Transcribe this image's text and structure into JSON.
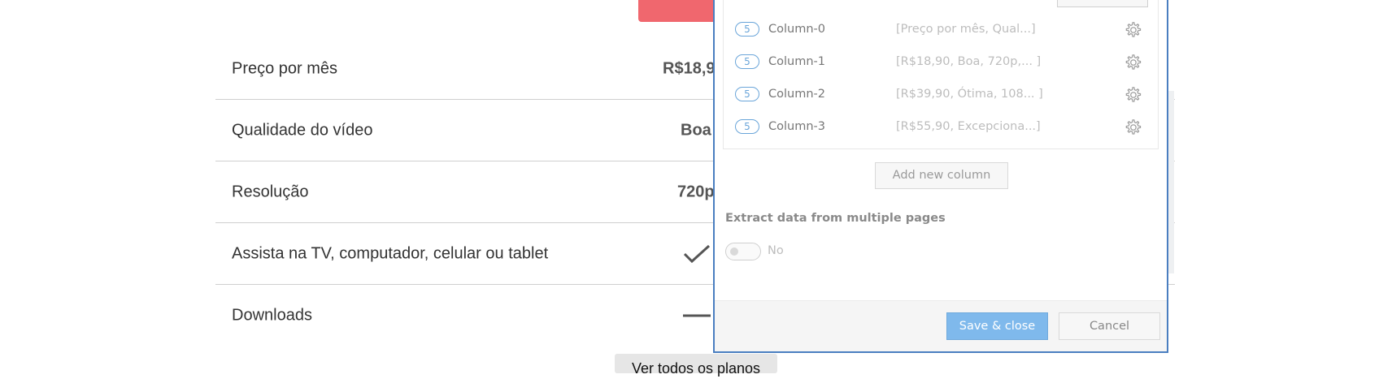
{
  "page": {
    "rows": [
      {
        "label": "Preço por mês",
        "value": "R$18,9"
      },
      {
        "label": "Qualidade do vídeo",
        "value": "Boa"
      },
      {
        "label": "Resolução",
        "value": "720p"
      },
      {
        "label": "Assista na TV, computador, celular ou tablet",
        "value_icon": "check-icon"
      },
      {
        "label": "Downloads",
        "value_icon": "dash-icon"
      }
    ],
    "see_all_label": "Ver todos os planos"
  },
  "dialog": {
    "columns": [
      {
        "count": "5",
        "name": "Column-0",
        "preview": "[Preço por mês, Qual...]"
      },
      {
        "count": "5",
        "name": "Column-1",
        "preview": "[R$18,90, Boa, 720p,... ]"
      },
      {
        "count": "5",
        "name": "Column-2",
        "preview": "[R$39,90, Ótima, 108... ]"
      },
      {
        "count": "5",
        "name": "Column-3",
        "preview": "[R$55,90, Excepciona...]"
      }
    ],
    "add_column_label": "Add new column",
    "multi_page_label": "Extract data from multiple pages",
    "multi_page_toggle_text": "No",
    "save_label": "Save & close",
    "cancel_label": "Cancel"
  },
  "colors": {
    "accent_red": "#f0676e",
    "dialog_border": "#4a7ec0",
    "save_blue": "#7fb9ec",
    "pill_blue": "#6aa5d9"
  }
}
